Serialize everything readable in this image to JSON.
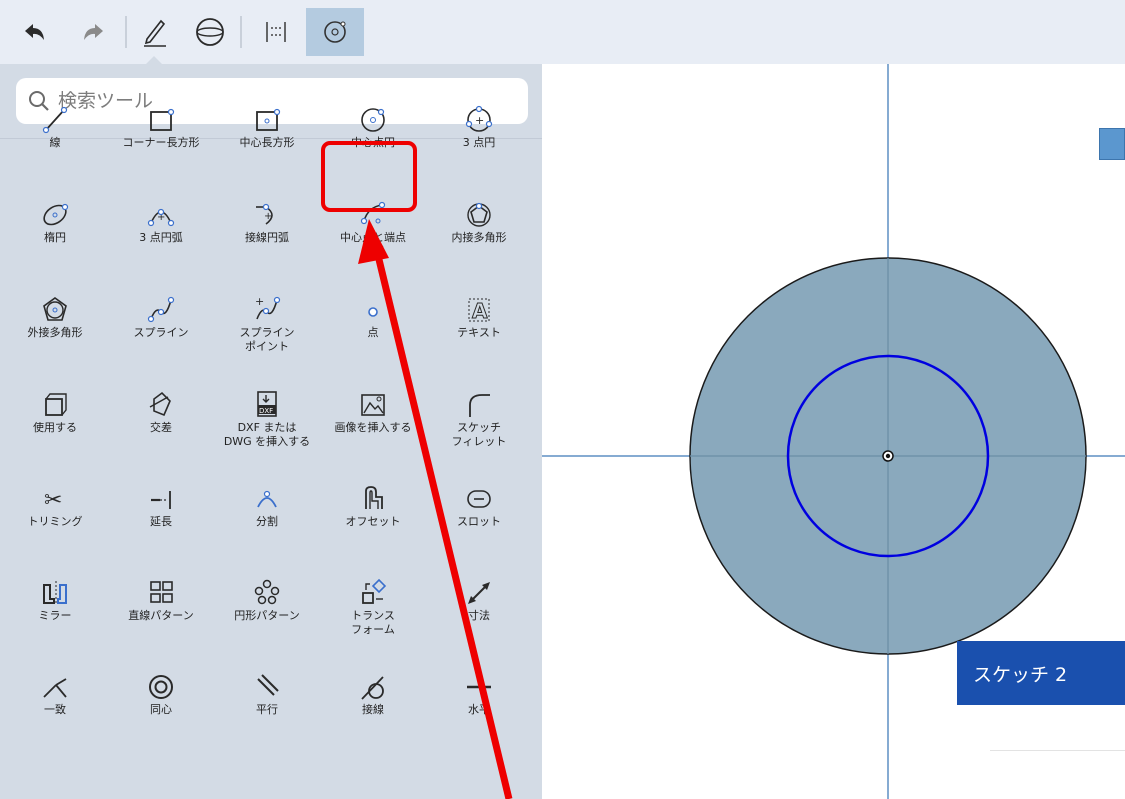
{
  "toolbar": {
    "items": [
      "undo-icon",
      "redo-icon",
      "sketch-pen-icon",
      "sphere-icon",
      "align-icon",
      "circle-settings-icon"
    ]
  },
  "search": {
    "placeholder": "検索ツール"
  },
  "tools": [
    {
      "icon": "line-icon",
      "label": "線"
    },
    {
      "icon": "corner-rectangle-icon",
      "label": "コーナー長方形"
    },
    {
      "icon": "center-rectangle-icon",
      "label": "中心長方形"
    },
    {
      "icon": "center-circle-icon",
      "label": "中心点円"
    },
    {
      "icon": "three-point-circle-icon",
      "label": "3 点円"
    },
    {
      "icon": "ellipse-icon",
      "label": "楕円"
    },
    {
      "icon": "three-point-arc-icon",
      "label": "3 点円弧"
    },
    {
      "icon": "tangent-arc-icon",
      "label": "接線円弧"
    },
    {
      "icon": "center-point-arc-icon",
      "label": "中心点と端点\n円弧"
    },
    {
      "icon": "inscribed-polygon-icon",
      "label": "内接多角形"
    },
    {
      "icon": "circumscribed-polygon-icon",
      "label": "外接多角形"
    },
    {
      "icon": "spline-icon",
      "label": "スプライン"
    },
    {
      "icon": "spline-point-icon",
      "label": "スプライン\nポイント"
    },
    {
      "icon": "point-icon",
      "label": "点"
    },
    {
      "icon": "text-icon",
      "label": "テキスト"
    },
    {
      "icon": "use-icon",
      "label": "使用する"
    },
    {
      "icon": "intersect-icon",
      "label": "交差"
    },
    {
      "icon": "dxf-icon",
      "label": "DXF または\nDWG を挿入する"
    },
    {
      "icon": "insert-image-icon",
      "label": "画像を挿入する"
    },
    {
      "icon": "sketch-fillet-icon",
      "label": "スケッチ\nフィレット"
    },
    {
      "icon": "trim-icon",
      "label": "トリミング"
    },
    {
      "icon": "extend-icon",
      "label": "延長"
    },
    {
      "icon": "split-icon",
      "label": "分割"
    },
    {
      "icon": "offset-icon",
      "label": "オフセット"
    },
    {
      "icon": "slot-icon",
      "label": "スロット"
    },
    {
      "icon": "mirror-icon",
      "label": "ミラー"
    },
    {
      "icon": "linear-pattern-icon",
      "label": "直線パターン"
    },
    {
      "icon": "circular-pattern-icon",
      "label": "円形パターン"
    },
    {
      "icon": "transform-icon",
      "label": "トランス\nフォーム"
    },
    {
      "icon": "dimension-icon",
      "label": "寸法"
    },
    {
      "icon": "coincident-icon",
      "label": "一致"
    },
    {
      "icon": "concentric-icon",
      "label": "同心"
    },
    {
      "icon": "parallel-icon",
      "label": "平行"
    },
    {
      "icon": "tangent-icon",
      "label": "接線"
    },
    {
      "icon": "horizontal-icon",
      "label": "水平"
    }
  ],
  "sketch_panel": {
    "title": "スケッチ 2"
  },
  "colors": {
    "accent": "#1a50ae",
    "highlight": "#ee0000",
    "circle_fill": "#86a6bb",
    "inner_circle": "#0000e0",
    "axis": "#5e8fc4"
  }
}
